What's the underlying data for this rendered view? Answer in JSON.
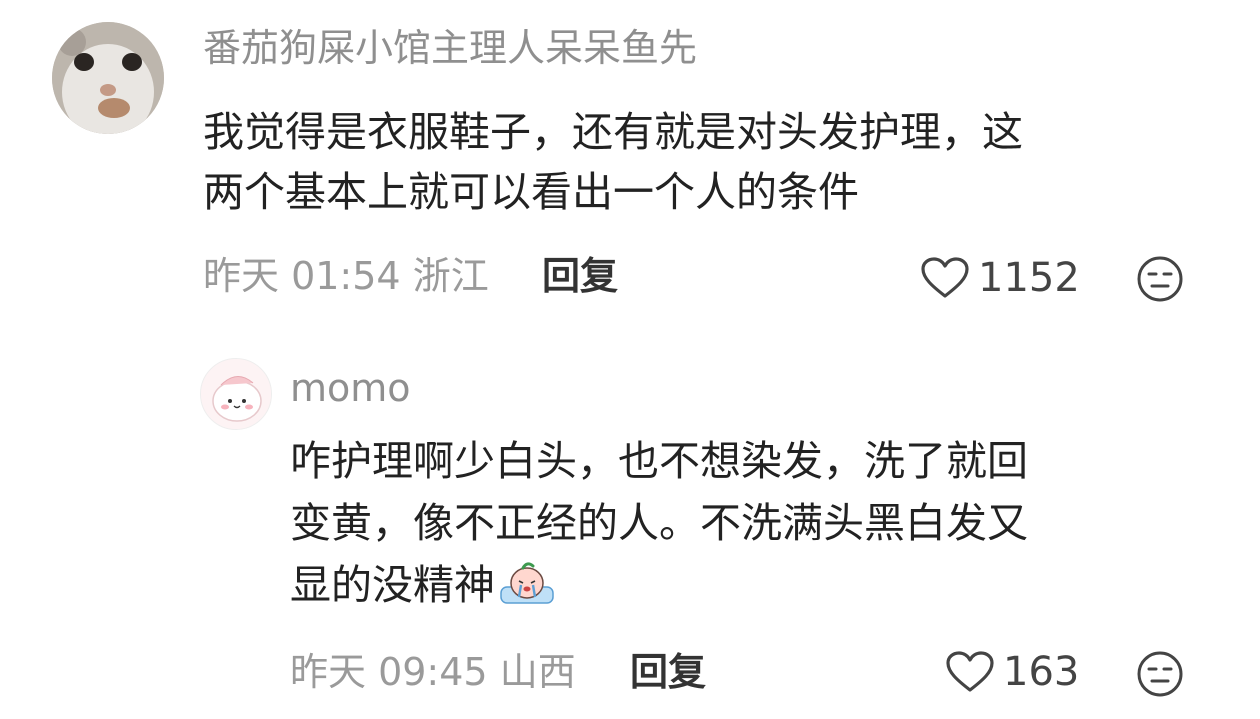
{
  "comments": [
    {
      "username": "番茄狗屎小馆主理人呆呆鱼先",
      "lines": [
        "我觉得是衣服鞋子，还有就是对头发护理，这",
        "两个基本上就可以看出一个人的条件"
      ],
      "time": "昨天 01:54",
      "location": "浙江",
      "reply_label": "回复",
      "likes": "1152"
    },
    {
      "username": "momo",
      "lines": [
        "咋护理啊少白头，也不想染发，洗了就回",
        "变黄，像不正经的人。不洗满头黑白发又",
        "显的没精神"
      ],
      "time": "昨天 09:45",
      "location": "山西",
      "reply_label": "回复",
      "likes": "163"
    }
  ],
  "colors": {
    "text_primary": "#222222",
    "text_secondary": "#9a9a9a",
    "username": "#8f8f8f"
  }
}
